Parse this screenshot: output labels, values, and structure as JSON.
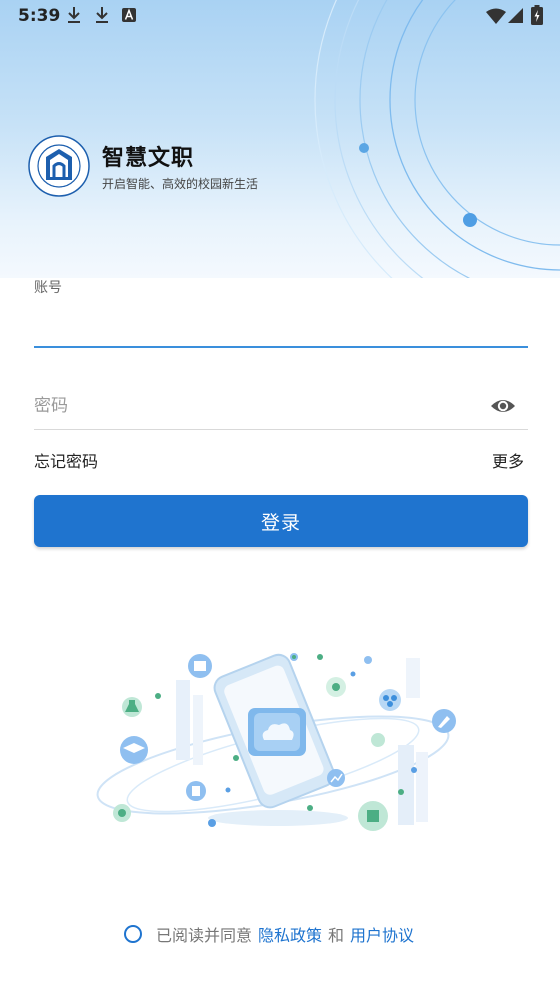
{
  "status_bar": {
    "time": "5:39",
    "left_icons": [
      "download-icon",
      "download-icon",
      "font-a-icon"
    ],
    "right_icons": [
      "wifi-icon",
      "signal-icon",
      "battery-charging-icon"
    ]
  },
  "header": {
    "title": "智慧文职",
    "subtitle": "开启智能、高效的校园新生活",
    "accent_color": "#1f74cf"
  },
  "login_form": {
    "account_label": "账号",
    "account_value": "",
    "password_placeholder": "密码",
    "password_value": "",
    "forgot_password": "忘记密码",
    "more": "更多",
    "login_button": "登录"
  },
  "agreement": {
    "text_prefix": "已阅读并同意",
    "privacy_policy": "隐私政策",
    "conjunction": "和",
    "user_agreement": "用户协议",
    "checked": false
  }
}
